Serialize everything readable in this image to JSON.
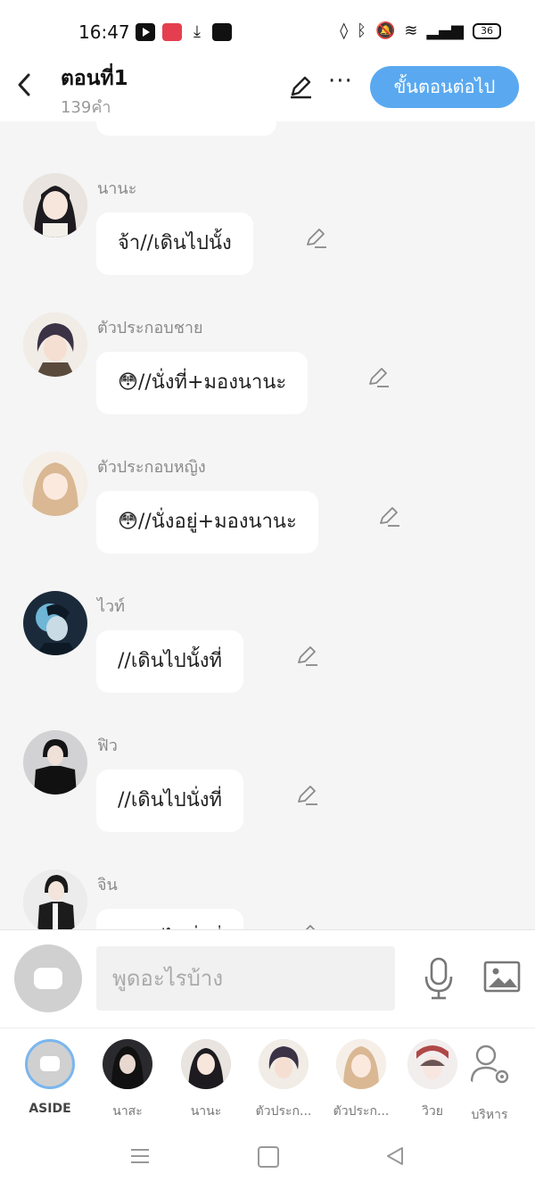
{
  "status_bar": {
    "time": "16:47",
    "battery": "36"
  },
  "header": {
    "title": "ตอนที่1",
    "subtitle": "139คำ",
    "next_button": "ขั้นตอนต่อไป",
    "more": "···"
  },
  "messages": [
    {
      "name": "นานะ",
      "text": "จ้า//เดินไปนั้ง"
    },
    {
      "name": "ตัวประกอบชาย",
      "text": "😳//นั่งที่+มองนานะ"
    },
    {
      "name": "ตัวประกอบหญิง",
      "text": "😳//นั่งอยู่+มองนานะ"
    },
    {
      "name": "ไวท์",
      "text": "//เดินไปนั้งที่"
    },
    {
      "name": "ฟิว",
      "text": "//เดินไปนั่งที่"
    },
    {
      "name": "จิน",
      "text": "//เดินไปนั่งที่"
    }
  ],
  "input": {
    "placeholder": "พูดอะไรบ้าง"
  },
  "characters": [
    {
      "label": "ASIDE"
    },
    {
      "label": "นาสะ"
    },
    {
      "label": "นานะ"
    },
    {
      "label": "ตัวประก..."
    },
    {
      "label": "ตัวประก..."
    },
    {
      "label": "วิวย"
    },
    {
      "label": "บริหาร"
    }
  ],
  "colors": {
    "accent": "#5aa9f0",
    "bubble": "#ffffff",
    "background": "#f5f5f5"
  }
}
